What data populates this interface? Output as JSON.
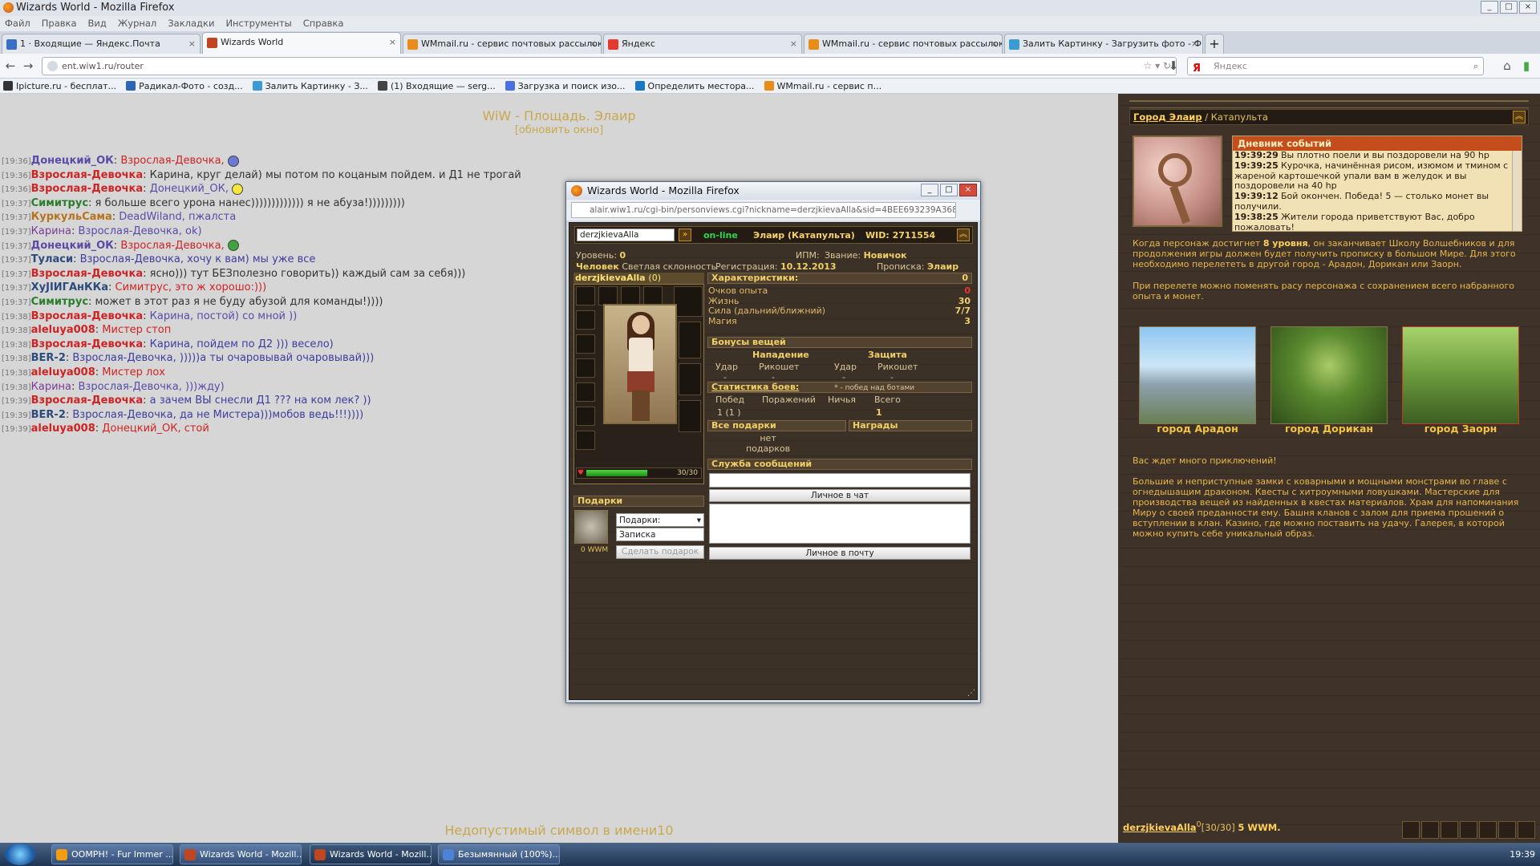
{
  "window": {
    "title": "Wizards World - Mozilla Firefox"
  },
  "menu": [
    "Файл",
    "Правка",
    "Вид",
    "Журнал",
    "Закладки",
    "Инструменты",
    "Справка"
  ],
  "tabs": [
    {
      "label": "1 · Входящие — Яндекс.Почта",
      "color": "#3b6fc4"
    },
    {
      "label": "Wizards World",
      "color": "#c0461f",
      "active": true
    },
    {
      "label": "WMmail.ru - сервис почтовых рассылок...",
      "color": "#e88c1a"
    },
    {
      "label": "Яндекс",
      "color": "#e23b2e"
    },
    {
      "label": "WMmail.ru - сервис почтовых рассылок...",
      "color": "#e88c1a"
    },
    {
      "label": "Залить Картинку - Загрузить фото - Ф...",
      "color": "#3a9bd5"
    }
  ],
  "url": "ent.wiw1.ru/router",
  "search_placeholder": "Яндекс",
  "bookmarks": [
    {
      "label": "Ipicture.ru - бесплат...",
      "color": "#333"
    },
    {
      "label": "Радикал-Фото - созд...",
      "color": "#2c64b8"
    },
    {
      "label": "Залить Картинку - З...",
      "color": "#3a9bd5"
    },
    {
      "label": "(1) Входящие — serg...",
      "color": "#444"
    },
    {
      "label": "Загрузка и поиск изо...",
      "color": "#4a6fe0"
    },
    {
      "label": "Определить местора...",
      "color": "#1a78c2"
    },
    {
      "label": "WMmail.ru - сервис п...",
      "color": "#e88c1a"
    }
  ],
  "chat": {
    "title": "WiW - Площадь. Элаир",
    "refresh": "[обновить окно]",
    "lines": [
      {
        "time": "[19:36]",
        "nick": "Донецкий_ОК",
        "nc": "n1",
        "to": "Взрослая-Девочка,",
        "tc": "to1",
        "msg": "",
        "smile": "#6a7ad6"
      },
      {
        "time": "[19:36]",
        "nick": "Взрослая-Девочка",
        "nc": "n2",
        "to": "",
        "tc": "",
        "msg": "Карина, круг делай) мы потом по коцаным пойдем. и Д1 не трогай"
      },
      {
        "time": "[19:36]",
        "nick": "Взрослая-Девочка",
        "nc": "n2",
        "to": "Донецкий_ОК,",
        "tc": "to2",
        "msg": "",
        "smile": "#f7e640"
      },
      {
        "time": "[19:37]",
        "nick": "Симитрус",
        "nc": "n3",
        "to": "",
        "tc": "",
        "msg": "я больше всего урона нанес))))))))))))) я не абуза!)))))))))"
      },
      {
        "time": "[19:37]",
        "nick": "КуркульСама",
        "nc": "n4",
        "to": "DeadWiland, пжалста",
        "tc": "to2",
        "msg": ""
      },
      {
        "time": "[19:37]",
        "nick": "Карина",
        "nc": "n6",
        "to": "Взрослая-Девочка, ok)",
        "tc": "to2",
        "msg": ""
      },
      {
        "time": "[19:37]",
        "nick": "Донецкий_ОК",
        "nc": "n1",
        "to": "Взрослая-Девочка,",
        "tc": "to1",
        "msg": "",
        "smile": "#3fa33f"
      },
      {
        "time": "[19:37]",
        "nick": "Туласи",
        "nc": "n5",
        "to": "",
        "tc": "",
        "msg": "Взрослая-Девочка, хочу к вам) мы уже все",
        "blue": true
      },
      {
        "time": "[19:37]",
        "nick": "Взрослая-Девочка",
        "nc": "n2",
        "to": "",
        "tc": "",
        "msg": "ясно))) тут БЕЗполезно говорить)) каждый сам за себя)))"
      },
      {
        "time": "[19:37]",
        "nick": "ХуЈIИГАнККа",
        "nc": "n5",
        "to": "Симитрус, это ж хорошо:)))",
        "tc": "to1",
        "msg": ""
      },
      {
        "time": "[19:37]",
        "nick": "Симитрус",
        "nc": "n3",
        "to": "",
        "tc": "",
        "msg": "может в этот раз я не буду абузой для команды!))))"
      },
      {
        "time": "[19:38]",
        "nick": "Взрослая-Девочка",
        "nc": "n2",
        "to": "Карина, постой) со мной ))",
        "tc": "to2",
        "msg": ""
      },
      {
        "time": "[19:38]",
        "nick": "aleluya008",
        "nc": "n2",
        "to": "Мистер стоп",
        "tc": "to1",
        "msg": ""
      },
      {
        "time": "[19:38]",
        "nick": "Взрослая-Девочка",
        "nc": "n2",
        "to": "",
        "tc": "",
        "msg": "Карина, пойдем по Д2 ))) весело)",
        "blue": true
      },
      {
        "time": "[19:38]",
        "nick": "BER-2",
        "nc": "n5",
        "to": "",
        "tc": "",
        "msg": "Взрослая-Девочка, )))))а ты очаровывай очаровывай)))",
        "blue": true
      },
      {
        "time": "[19:38]",
        "nick": "aleluya008",
        "nc": "n2",
        "to": "Мистер лох",
        "tc": "to1",
        "msg": ""
      },
      {
        "time": "[19:38]",
        "nick": "Карина",
        "nc": "n6",
        "to": "Взрослая-Девочка, )))жду)",
        "tc": "to2",
        "msg": ""
      },
      {
        "time": "[19:39]",
        "nick": "Взрослая-Девочка",
        "nc": "n2",
        "to": "",
        "tc": "",
        "msg": "а зачем ВЫ снесли Д1 ??? на ком лек? ))",
        "blue": true
      },
      {
        "time": "[19:39]",
        "nick": "BER-2",
        "nc": "n5",
        "to": "",
        "tc": "",
        "msg": "Взрослая-Девочка, да не Мистера)))мобов ведь!!!))))",
        "blue": true
      },
      {
        "time": "[19:39]",
        "nick": "aleluya008",
        "nc": "n2",
        "to": "Донецкий_ОК, стой",
        "tc": "to1",
        "msg": ""
      }
    ],
    "warning": "Недопустимый символ в имени10"
  },
  "popup": {
    "title": "Wizards World - Mozilla Firefox",
    "url": "alair.wiw1.ru/cgi-bin/personviews.cgi?nickname=derzjkievaAlla&sid=4BEE693239A368E…",
    "nick_value": "derzjkievaAlla",
    "online": "on-line",
    "town": "Элаир (Катапульта)",
    "wid": "WID: 2711554",
    "level_label": "Уровень:",
    "level": "0",
    "ipm_label": "ИПМ:",
    "rank_label": "Звание:",
    "rank": "Новичок",
    "race": "Человек",
    "align": "Светлая склонность",
    "reg_label": "Регистрация:",
    "reg": "10.12.2013",
    "prop_label": "Прописка:",
    "prop": "Элаир",
    "char_name": "derzjkievaAlla",
    "char_count": "(0)",
    "hp": "30/30",
    "gifts_title": "Подарки",
    "wwm": "0 WWM",
    "gift_select": "Подарки:",
    "note": "Записка",
    "make_gift": "Сделать подарок",
    "stats_title": "Характеристики:",
    "stats_val": "0",
    "stats": [
      {
        "label": "Очков опыта",
        "val": "0",
        "red": true
      },
      {
        "label": "Жизнь",
        "val": "30"
      },
      {
        "label": "Сила (дальний/ближний)",
        "val": "7/7"
      },
      {
        "label": "Магия",
        "val": "3"
      }
    ],
    "bonus_title": "Бонусы вещей",
    "attack": "Нападение",
    "defense": "Защита",
    "hit": "Удар",
    "ricochet": "Рикошет",
    "dash": "-",
    "fight_title": "Статистика боев:",
    "fight_note": "* - побед над ботами",
    "fight_cols": [
      "Побед",
      "Поражений",
      "Ничья",
      "Всего"
    ],
    "fight_vals": [
      "1 (1 )",
      "",
      "",
      "1"
    ],
    "all_gifts": "Все подарки",
    "awards": "Награды",
    "no_gifts": "нет\nподарков",
    "msg_service": "Служба сообщений",
    "to_chat": "Личное в чат",
    "to_mail": "Личное в почту"
  },
  "right": {
    "bc_town": "Город Элаир",
    "bc_sep": " / ",
    "bc_place": "Катапульта",
    "diary_title": "Дневник событий",
    "diary": [
      {
        "t": "19:39:29",
        "m": "Вы плотно поели и вы поздоровели на 90 hp"
      },
      {
        "t": "19:39:25",
        "m": "Курочка, начинённая рисом, изюмом и тмином с жареной картошечкой упали вам в желудок и вы поздоровели на 40 hp"
      },
      {
        "t": "19:39:12",
        "m": "Бой окончен. Победа! 5 — столько монет вы получили."
      },
      {
        "t": "19:38:25",
        "m": "Жители города приветствуют Вас, добро пожаловать!"
      }
    ],
    "text1_a": "Когда персонаж достигнет ",
    "text1_b": "8 уровня",
    "text1_c": ", он заканчивает Школу Волшебников и для продолжения игры должен будет получить прописку в большом Мире. Для этого необходимо перелететь в другой город - Арадон, Дорикан или Заорн.",
    "text2": "При перелете можно поменять расу персонажа с сохранением всего набранного опыта и монет.",
    "cities": [
      "город Арадон",
      "город Дорикан",
      "город Заорн"
    ],
    "text3": "Вас ждет много приключений!",
    "text4": "Большие и неприступные замки с коварными и мощными монстрами во главе с огнедышащим драконом. Квесты с хитроумными ловушками. Мастерские для производства вещей из найденных в квестах материалов. Храм для напоминания Миру о своей преданности ему. Башня кланов с залом для приема прошений о вступлении в клан. Казино, где можно поставить на удачу. Галерея, в которой можно купить себе уникальный образ.",
    "user": "derzjkievaAlla",
    "user_sup": "0",
    "user_hp": "[30/30]",
    "user_money": "5 WWM."
  },
  "taskbar": {
    "items": [
      {
        "label": "OOMPH! - Fur Immer ...",
        "color": "#f39c12"
      },
      {
        "label": "Wizards World - Mozill...",
        "color": "#c0461f"
      },
      {
        "label": "Wizards World - Mozill...",
        "color": "#c0461f",
        "active": true
      },
      {
        "label": "Безымянный (100%)...",
        "color": "#4d83d6"
      }
    ],
    "time": "19:39"
  }
}
